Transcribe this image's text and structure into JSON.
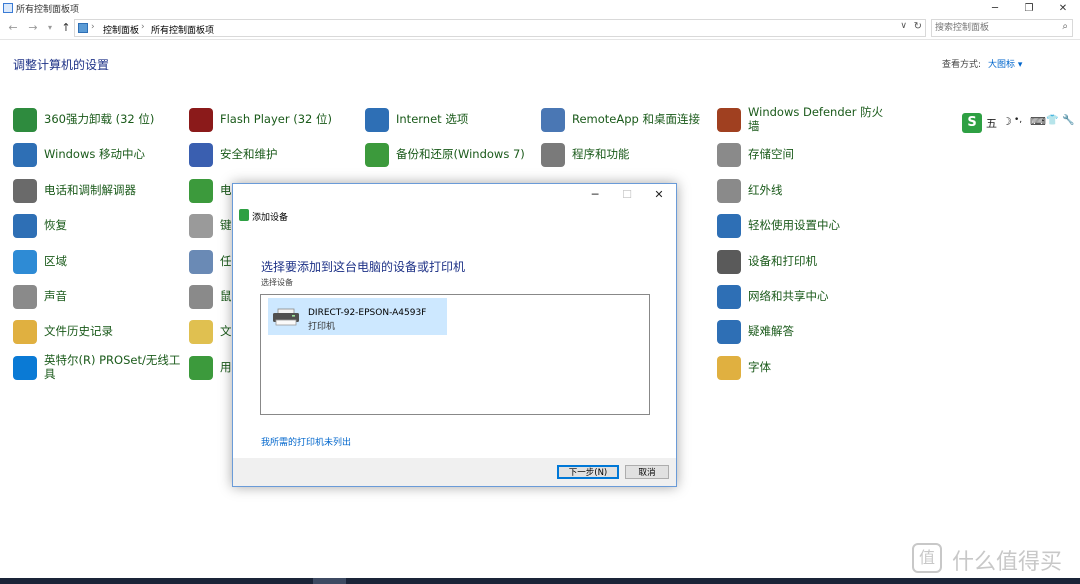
{
  "window": {
    "title": "所有控制面板项"
  },
  "address": {
    "crumbs": [
      "控制面板",
      "所有控制面板项"
    ],
    "sep": "›"
  },
  "search": {
    "placeholder": "搜索控制面板"
  },
  "header": {
    "heading": "调整计算机的设置",
    "view_by_label": "查看方式:",
    "view_by_value": "大图标 ▾"
  },
  "colors": {
    "accent": "#0066cc",
    "heading": "#1e3287",
    "item_text": "#1a5a1a",
    "selection": "#cde8ff"
  },
  "items": [
    {
      "label": "360强力卸载 (32 位)",
      "icon": "uninstall-icon",
      "color": "#2e8b3e"
    },
    {
      "label": "Flash Player (32 位)",
      "icon": "flash-icon",
      "color": "#8b1a1a"
    },
    {
      "label": "Internet 选项",
      "icon": "internet-options-icon",
      "color": "#2e6fb5"
    },
    {
      "label": "RemoteApp 和桌面连接",
      "icon": "remoteapp-icon",
      "color": "#4a77b4"
    },
    {
      "label": "Windows Defender 防火墙",
      "icon": "firewall-icon",
      "color": "#a04020"
    },
    {
      "label": "Windows 移动中心",
      "icon": "mobility-center-icon",
      "color": "#2e6fb5"
    },
    {
      "label": "安全和维护",
      "icon": "security-flag-icon",
      "color": "#3a5fb0"
    },
    {
      "label": "备份和还原(Windows 7)",
      "icon": "backup-icon",
      "color": "#3c9a3c"
    },
    {
      "label": "程序和功能",
      "icon": "programs-icon",
      "color": "#7a7a7a"
    },
    {
      "label": "存储空间",
      "icon": "storage-icon",
      "color": "#8a8a8a"
    },
    {
      "label": "电话和调制解调器",
      "icon": "phone-modem-icon",
      "color": "#6a6a6a"
    },
    {
      "label": "电",
      "icon": "power-icon",
      "color": "#3c9a3c"
    },
    {
      "label": "红外线",
      "icon": "infrared-icon",
      "color": "#8a8a8a"
    },
    {
      "label": "恢复",
      "icon": "recovery-icon",
      "color": "#2e6fb5"
    },
    {
      "label": "键",
      "icon": "keyboard-icon",
      "color": "#9a9a9a"
    },
    {
      "label": "轻松使用设置中心",
      "icon": "ease-of-access-icon",
      "color": "#2e6fb5"
    },
    {
      "label": "区域",
      "icon": "region-icon",
      "color": "#2e8bd5"
    },
    {
      "label": "任",
      "icon": "taskbar-icon",
      "color": "#6a8ab5"
    },
    {
      "label": "设备和打印机",
      "icon": "devices-printers-icon",
      "color": "#5a5a5a"
    },
    {
      "label": "声音",
      "icon": "sound-icon",
      "color": "#8a8a8a"
    },
    {
      "label": "鼠",
      "icon": "mouse-icon",
      "color": "#8a8a8a"
    },
    {
      "label": "网络和共享中心",
      "icon": "network-icon",
      "color": "#2e6fb5"
    },
    {
      "label": "文件历史记录",
      "icon": "file-history-icon",
      "color": "#e0b040"
    },
    {
      "label": "文",
      "icon": "folder-options-icon",
      "color": "#e0c050"
    },
    {
      "label": "疑难解答",
      "icon": "troubleshoot-icon",
      "color": "#2e6fb5"
    },
    {
      "label": "英特尔(R) PROSet/无线工具",
      "icon": "intel-wireless-icon",
      "color": "#0a7ad5"
    },
    {
      "label": "用",
      "icon": "user-accounts-icon",
      "color": "#3c9a3c"
    },
    {
      "label": "字体",
      "icon": "fonts-icon",
      "color": "#e0b040"
    }
  ],
  "ime": {
    "logo": "S",
    "mode": "五",
    "glyphs": [
      "☽",
      "•,",
      "⌨",
      "👕",
      "🔧"
    ]
  },
  "dialog": {
    "title": "添加设备",
    "heading": "选择要添加到这台电脑的设备或打印机",
    "subtitle": "选择设备",
    "device_name": "DIRECT-92-EPSON-A4593F",
    "device_type": "打印机",
    "not_listed": "我所需的打印机未列出",
    "next_label": "下一步(N)",
    "cancel_label": "取消"
  },
  "watermark": {
    "logo": "值",
    "text": "什么值得买"
  }
}
